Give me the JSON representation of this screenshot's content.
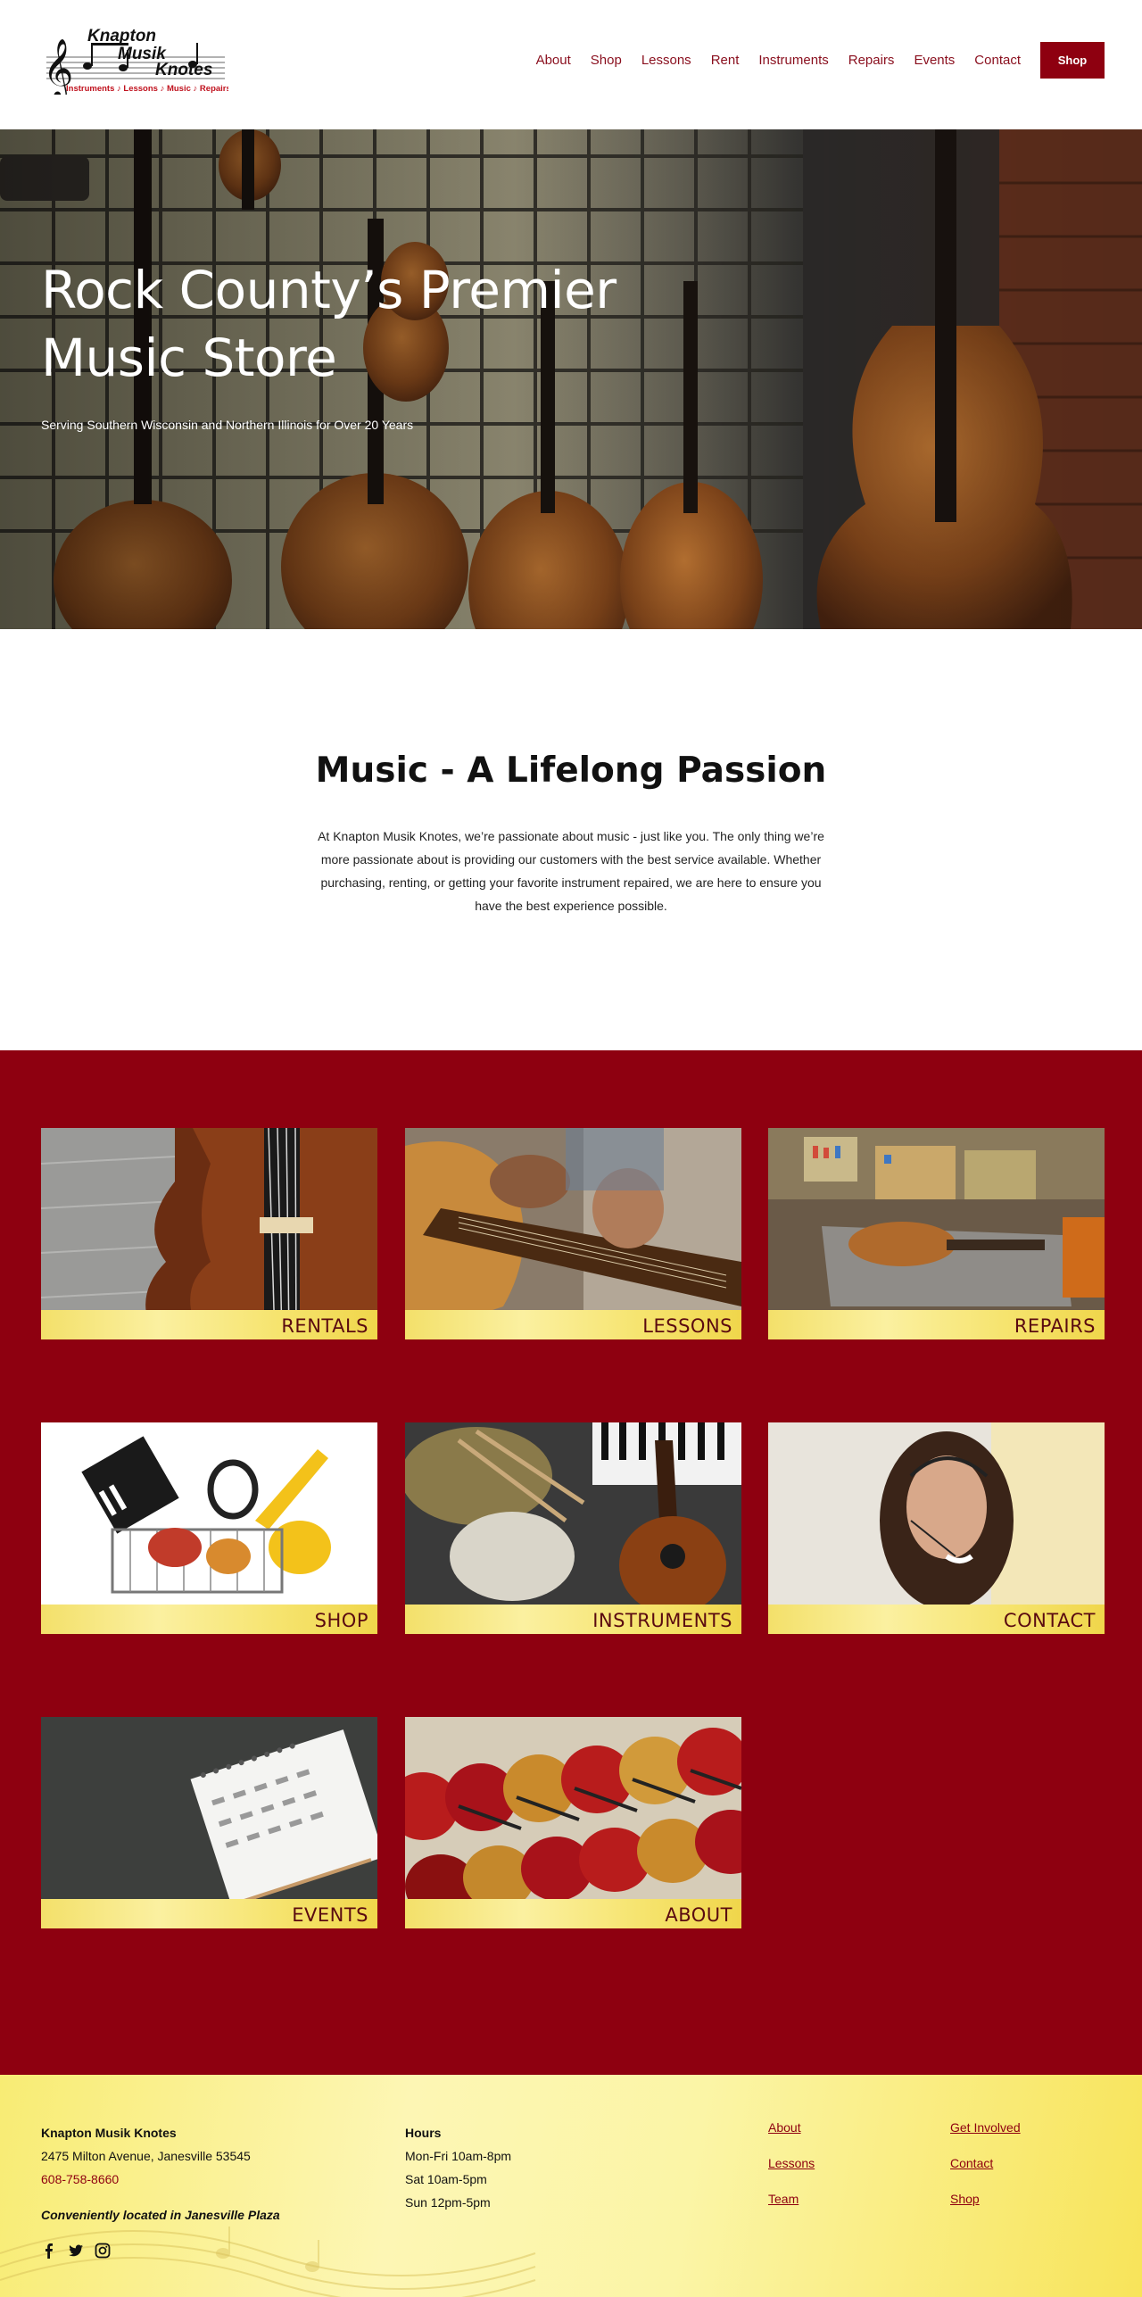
{
  "header": {
    "logo": {
      "line1": "Knapton",
      "line2": "Musik",
      "line3": "Knotes",
      "tagline": "Instruments ♪ Lessons ♪ Music ♪ Repairs"
    },
    "nav": [
      "About",
      "Shop",
      "Lessons",
      "Rent",
      "Instruments",
      "Repairs",
      "Events",
      "Contact"
    ],
    "cta": "Shop"
  },
  "hero": {
    "title": "Rock County’s Premier Music Store",
    "subtitle": "Serving Southern Wisconsin and Northern Illinois for Over 20 Years"
  },
  "intro": {
    "title": "Music - A Lifelong Passion",
    "text": "At Knapton Musik Knotes, we’re passionate about music - just like you. The only thing we’re more passionate about is providing our customers with the best service available. Whether purchasing, renting, or getting your favorite instrument repaired, we are here to ensure you have the best experience possible."
  },
  "tiles": [
    {
      "label": "RENTALS"
    },
    {
      "label": "LESSONS"
    },
    {
      "label": "REPAIRS"
    },
    {
      "label": "SHOP"
    },
    {
      "label": "INSTRUMENTS"
    },
    {
      "label": "CONTACT"
    },
    {
      "label": "EVENTS"
    },
    {
      "label": "ABOUT"
    }
  ],
  "footer": {
    "business": "Knapton Musik Knotes",
    "address": "2475 Milton Avenue, Janesville 53545",
    "phone": "608-758-8660",
    "location_note": "Conveniently located in Janesville Plaza",
    "hours_title": "Hours",
    "hours": [
      "Mon-Fri 10am-8pm",
      "Sat 10am-5pm",
      "Sun 12pm-5pm"
    ],
    "links_col1": [
      "About",
      "Lessons",
      "Team"
    ],
    "links_col2": [
      "Get Involved",
      "Contact",
      "Shop"
    ],
    "social_icons": [
      "facebook-icon",
      "twitter-icon",
      "instagram-icon"
    ]
  },
  "colors": {
    "brand_red": "#8e0010",
    "nav_text": "#8a0f1e",
    "band_yellow": "#f6e46f"
  }
}
